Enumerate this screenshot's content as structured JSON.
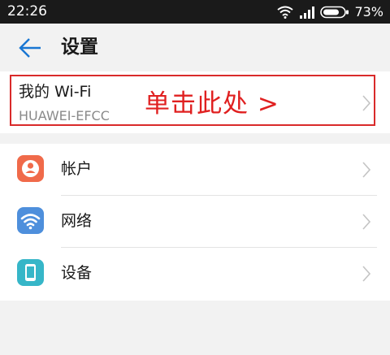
{
  "status_bar": {
    "time": "22:26",
    "battery": "73%"
  },
  "header": {
    "title": "设置"
  },
  "wifi": {
    "title": "我的 Wi-Fi",
    "network_name": "HUAWEI-EFCC",
    "annotation": "单击此处 >",
    "highlight_color": "#d92a2a"
  },
  "settings": {
    "items": [
      {
        "label": "帐户",
        "icon": "account-icon",
        "icon_color": "#f06a4a"
      },
      {
        "label": "网络",
        "icon": "wifi-icon",
        "icon_color": "#4e8fdc"
      },
      {
        "label": "设备",
        "icon": "device-icon",
        "icon_color": "#36b6c8"
      }
    ]
  },
  "colors": {
    "accent": "#1976d2",
    "annotation": "#e02020"
  }
}
